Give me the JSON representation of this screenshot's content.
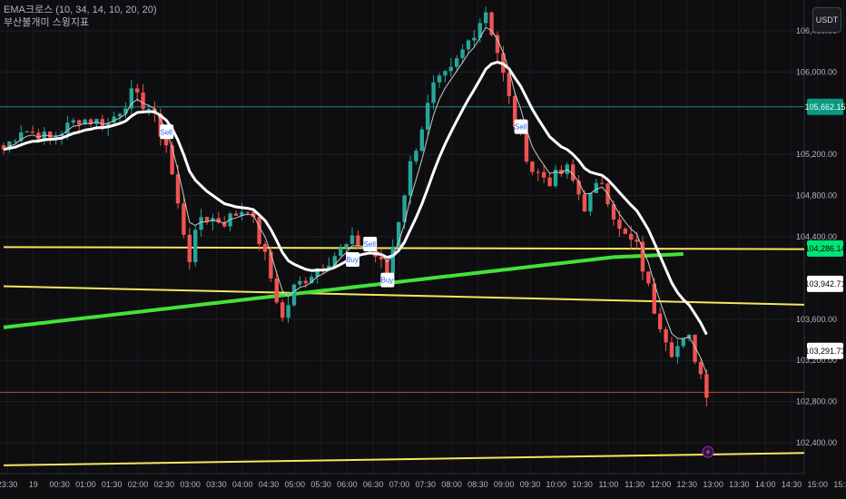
{
  "legend": {
    "indicator1": "EMA크로스 (10, 34, 14, 10, 20, 20)",
    "indicator2": "부산불개미 스윙지표"
  },
  "currency_button": "USDT",
  "chart_data": {
    "type": "candlestick",
    "ylim": [
      102100,
      106700
    ],
    "y_ticks": [
      {
        "value": 106400,
        "label": "106,400.00"
      },
      {
        "value": 106000,
        "label": "106,000.00"
      },
      {
        "value": 105200,
        "label": "105,200.00"
      },
      {
        "value": 104800,
        "label": "104,800.00"
      },
      {
        "value": 104400,
        "label": "104,400.00"
      },
      {
        "value": 103600,
        "label": "103,600.00"
      },
      {
        "value": 103200,
        "label": "103,200.00"
      },
      {
        "value": 102800,
        "label": "102,800.00"
      },
      {
        "value": 102400,
        "label": "102,400.00"
      }
    ],
    "x_ticks": [
      "23:30",
      "19",
      "00:30",
      "01:00",
      "01:30",
      "02:00",
      "02:30",
      "03:00",
      "03:30",
      "04:00",
      "04:30",
      "05:00",
      "05:30",
      "06:00",
      "06:30",
      "07:00",
      "07:30",
      "08:00",
      "08:30",
      "09:00",
      "09:30",
      "10:00",
      "10:30",
      "11:00",
      "11:30",
      "12:00",
      "12:30",
      "13:00",
      "13:30",
      "14:00",
      "14:30",
      "15:00",
      "15:30"
    ],
    "price_badges": [
      {
        "value": 105662.15,
        "label": "105,662.15",
        "bg": "#089981",
        "fg": "#ffffff"
      },
      {
        "value": 104286.14,
        "label": "104,286.14",
        "bg": "#00e676",
        "fg": "#000000"
      },
      {
        "value": 103942.71,
        "label": "103,942.71",
        "bg": "#ffffff",
        "fg": "#000000"
      },
      {
        "value": 103291.73,
        "label": "103,291.73",
        "bg": "#ffffff",
        "fg": "#000000"
      }
    ],
    "signals": [
      {
        "label": "Sell",
        "index": 28,
        "price": 105420,
        "type": "sell"
      },
      {
        "label": "Sell",
        "index": 63,
        "price": 104330,
        "type": "sell"
      },
      {
        "label": "Buy",
        "index": 60,
        "price": 104180,
        "type": "buy"
      },
      {
        "label": "Buy",
        "index": 66,
        "price": 103980,
        "type": "buy"
      },
      {
        "label": "Sell",
        "index": 89,
        "price": 105470,
        "type": "sell"
      }
    ],
    "trend_lines": [
      {
        "name": "",
        "color": "#f5e663",
        "from": [
          0,
          104300
        ],
        "to": [
          140,
          104280
        ]
      },
      {
        "name": "",
        "color": "#f5e663",
        "from": [
          0,
          103920
        ],
        "to": [
          140,
          103740
        ]
      },
      {
        "name": "",
        "color": "#f5e663",
        "from": [
          0,
          102180
        ],
        "to": [
          140,
          102300
        ]
      }
    ],
    "horizontal_lines": [
      {
        "value": 105662.15,
        "color": "#26a69a"
      },
      {
        "value": 102890,
        "color": "#ef5350"
      }
    ],
    "ma_fast_color": "#c8c8c8",
    "ma_slow_color": "#ffffff",
    "ma_long_color": "#43e23a",
    "up_color": "#26a69a",
    "down_color": "#ef5350",
    "key_points": [
      [
        0,
        105250
      ],
      [
        3,
        105450
      ],
      [
        8,
        105350
      ],
      [
        13,
        105550
      ],
      [
        18,
        105500
      ],
      [
        22,
        105780
      ],
      [
        25,
        105650
      ],
      [
        28,
        105300
      ],
      [
        30,
        104700
      ],
      [
        32,
        104200
      ],
      [
        34,
        104600
      ],
      [
        38,
        104550
      ],
      [
        42,
        104700
      ],
      [
        45,
        104200
      ],
      [
        48,
        103600
      ],
      [
        50,
        103900
      ],
      [
        54,
        104100
      ],
      [
        60,
        104350
      ],
      [
        63,
        104300
      ],
      [
        66,
        104050
      ],
      [
        70,
        105100
      ],
      [
        74,
        105850
      ],
      [
        77,
        106000
      ],
      [
        80,
        106300
      ],
      [
        83,
        106600
      ],
      [
        85,
        106200
      ],
      [
        88,
        105500
      ],
      [
        91,
        105050
      ],
      [
        94,
        104950
      ],
      [
        97,
        105050
      ],
      [
        100,
        104700
      ],
      [
        103,
        104950
      ],
      [
        106,
        104450
      ],
      [
        109,
        104300
      ],
      [
        112,
        103700
      ],
      [
        115,
        103300
      ],
      [
        118,
        103400
      ],
      [
        121,
        102900
      ]
    ],
    "candle_count": 122,
    "seed": 7
  }
}
